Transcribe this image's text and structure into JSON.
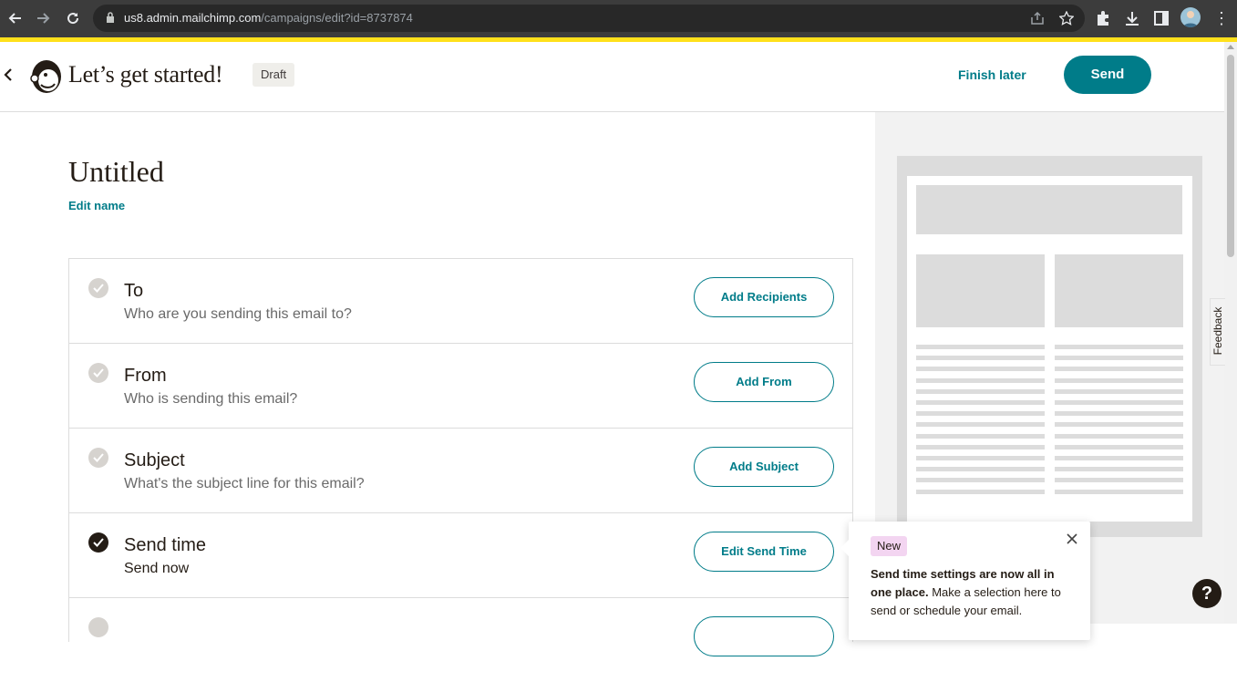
{
  "browser": {
    "url_host": "us8.admin.mailchimp.com",
    "url_path": "/campaigns/edit?id=8737874"
  },
  "header": {
    "title": "Let’s get started!",
    "status_badge": "Draft",
    "finish_later": "Finish later",
    "send": "Send"
  },
  "campaign": {
    "name": "Untitled",
    "edit_name": "Edit name"
  },
  "checklist": [
    {
      "title": "To",
      "subtitle": "Who are you sending this email to?",
      "action": "Add Recipients",
      "complete": false
    },
    {
      "title": "From",
      "subtitle": "Who is sending this email?",
      "action": "Add From",
      "complete": false
    },
    {
      "title": "Subject",
      "subtitle": "What's the subject line for this email?",
      "action": "Add Subject",
      "complete": false
    },
    {
      "title": "Send time",
      "subtitle": "Send now",
      "action": "Edit Send Time",
      "complete": true
    }
  ],
  "popover": {
    "badge": "New",
    "bold_text": "Send time settings are now all in one place.",
    "text": " Make a selection here to send or schedule your email."
  },
  "feedback_tab": "Feedback",
  "help": "?",
  "colors": {
    "brand_teal": "#007c89",
    "brand_yellow": "#ffe01b",
    "dark": "#241c15"
  }
}
